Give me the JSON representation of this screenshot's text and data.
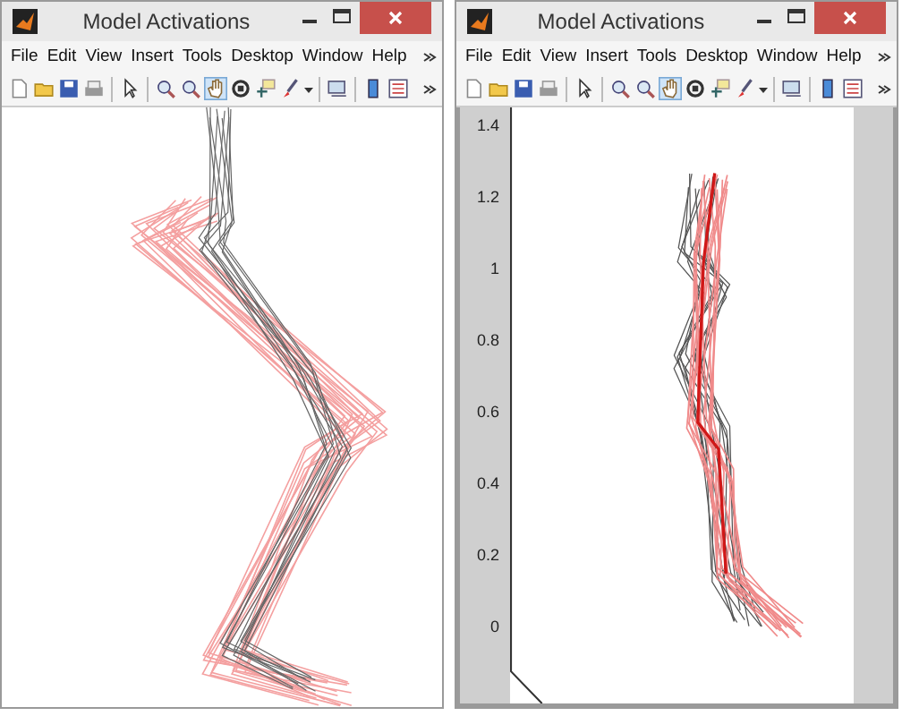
{
  "windows": [
    {
      "title": "Model Activations",
      "menu": [
        "File",
        "Edit",
        "View",
        "Insert",
        "Tools",
        "Desktop",
        "Window",
        "Help"
      ],
      "toolbar": [
        [
          {
            "kind": "new",
            "selected": false
          },
          {
            "kind": "open",
            "selected": false
          },
          {
            "kind": "save",
            "selected": false
          },
          {
            "kind": "print",
            "selected": false
          }
        ],
        [
          {
            "kind": "pointer",
            "selected": false
          }
        ],
        [
          {
            "kind": "zoom-in",
            "selected": false
          },
          {
            "kind": "zoom-out",
            "selected": false
          },
          {
            "kind": "pan",
            "selected": true
          },
          {
            "kind": "rotate",
            "selected": false
          },
          {
            "kind": "cursor",
            "selected": false
          },
          {
            "kind": "brush",
            "selected": false
          }
        ],
        [
          {
            "kind": "link",
            "selected": false
          }
        ],
        [
          {
            "kind": "colorbar",
            "selected": false
          },
          {
            "kind": "legend",
            "selected": false
          }
        ]
      ],
      "plot": {
        "kind": "bare"
      }
    },
    {
      "title": "Model Activations",
      "menu": [
        "File",
        "Edit",
        "View",
        "Insert",
        "Tools",
        "Desktop",
        "Window",
        "Help"
      ],
      "toolbar": [
        [
          {
            "kind": "new",
            "selected": false
          },
          {
            "kind": "open",
            "selected": false
          },
          {
            "kind": "save",
            "selected": false
          },
          {
            "kind": "print",
            "selected": false
          }
        ],
        [
          {
            "kind": "pointer",
            "selected": false
          }
        ],
        [
          {
            "kind": "zoom-in",
            "selected": false
          },
          {
            "kind": "zoom-out",
            "selected": false
          },
          {
            "kind": "pan",
            "selected": true
          },
          {
            "kind": "rotate",
            "selected": false
          },
          {
            "kind": "cursor",
            "selected": false
          },
          {
            "kind": "brush",
            "selected": false
          }
        ],
        [
          {
            "kind": "link",
            "selected": false
          }
        ],
        [
          {
            "kind": "colorbar",
            "selected": false
          },
          {
            "kind": "legend",
            "selected": false
          }
        ]
      ],
      "plot": {
        "kind": "axes",
        "yticks": [
          "1.4",
          "1.2",
          "1",
          "0.8",
          "0.6",
          "0.4",
          "0.2",
          "0"
        ]
      }
    }
  ]
}
